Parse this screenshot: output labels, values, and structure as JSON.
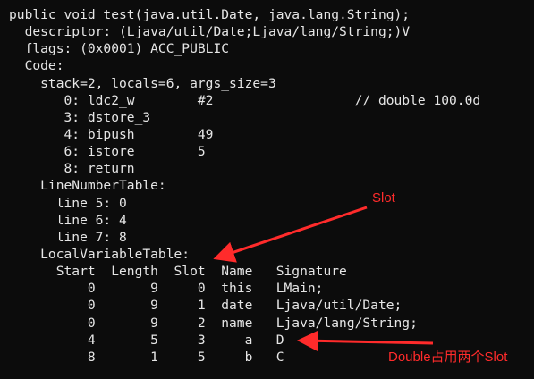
{
  "terminal": {
    "lines": [
      "public void test(java.util.Date, java.lang.String);",
      "  descriptor: (Ljava/util/Date;Ljava/lang/String;)V",
      "  flags: (0x0001) ACC_PUBLIC",
      "  Code:",
      "    stack=2, locals=6, args_size=3",
      "       0: ldc2_w        #2                  // double 100.0d",
      "       3: dstore_3",
      "       4: bipush        49",
      "       6: istore        5",
      "       8: return",
      "    LineNumberTable:",
      "      line 5: 0",
      "      line 6: 4",
      "      line 7: 8",
      "    LocalVariableTable:",
      "      Start  Length  Slot  Name   Signature",
      "          0       9     0  this   LMain;",
      "          0       9     1  date   Ljava/util/Date;",
      "          0       9     2  name   Ljava/lang/String;",
      "          4       5     3     a   D",
      "          8       1     5     b   C"
    ]
  },
  "annotations": {
    "slot_label": "Slot",
    "double_label": "Double占用两个Slot",
    "color": "#ff2b2b"
  }
}
